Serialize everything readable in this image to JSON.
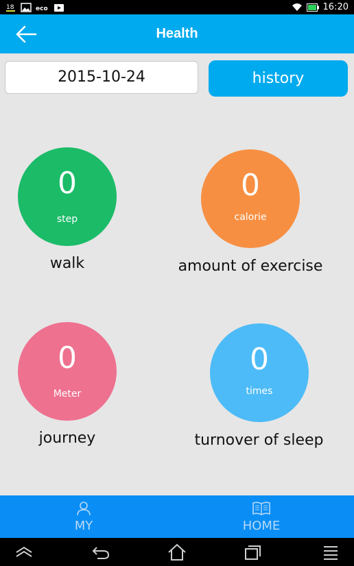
{
  "status_bar": {
    "time": "16:20",
    "icons": [
      "notification-icon",
      "image-icon",
      "eco-icon",
      "video-icon",
      "wifi-icon",
      "battery-icon"
    ]
  },
  "app_bar": {
    "title": "Health",
    "back_icon": "arrow-left-icon"
  },
  "date_selector": {
    "date": "2015-10-24",
    "history_label": "history"
  },
  "metrics": [
    {
      "label": "walk",
      "value": "0",
      "unit": "step",
      "color": "#1bbb68"
    },
    {
      "label": "amount of exercise",
      "value": "0",
      "unit": "calorie",
      "color": "#f78f42"
    },
    {
      "label": "journey",
      "value": "0",
      "unit": "Meter",
      "color": "#ee7190"
    },
    {
      "label": "turnover of sleep",
      "value": "0",
      "unit": "times",
      "color": "#4dbbf7"
    }
  ],
  "tabs": [
    {
      "label": "MY",
      "icon": "person-icon"
    },
    {
      "label": "HOME",
      "icon": "book-icon"
    }
  ],
  "system_nav": [
    "recent-apps-up-icon",
    "back-icon",
    "home-icon",
    "overview-icon",
    "menu-icon"
  ],
  "colors": {
    "app_bar": "#00aaee",
    "tab_bar": "#0a8ef5",
    "background": "#e6e6e6"
  }
}
